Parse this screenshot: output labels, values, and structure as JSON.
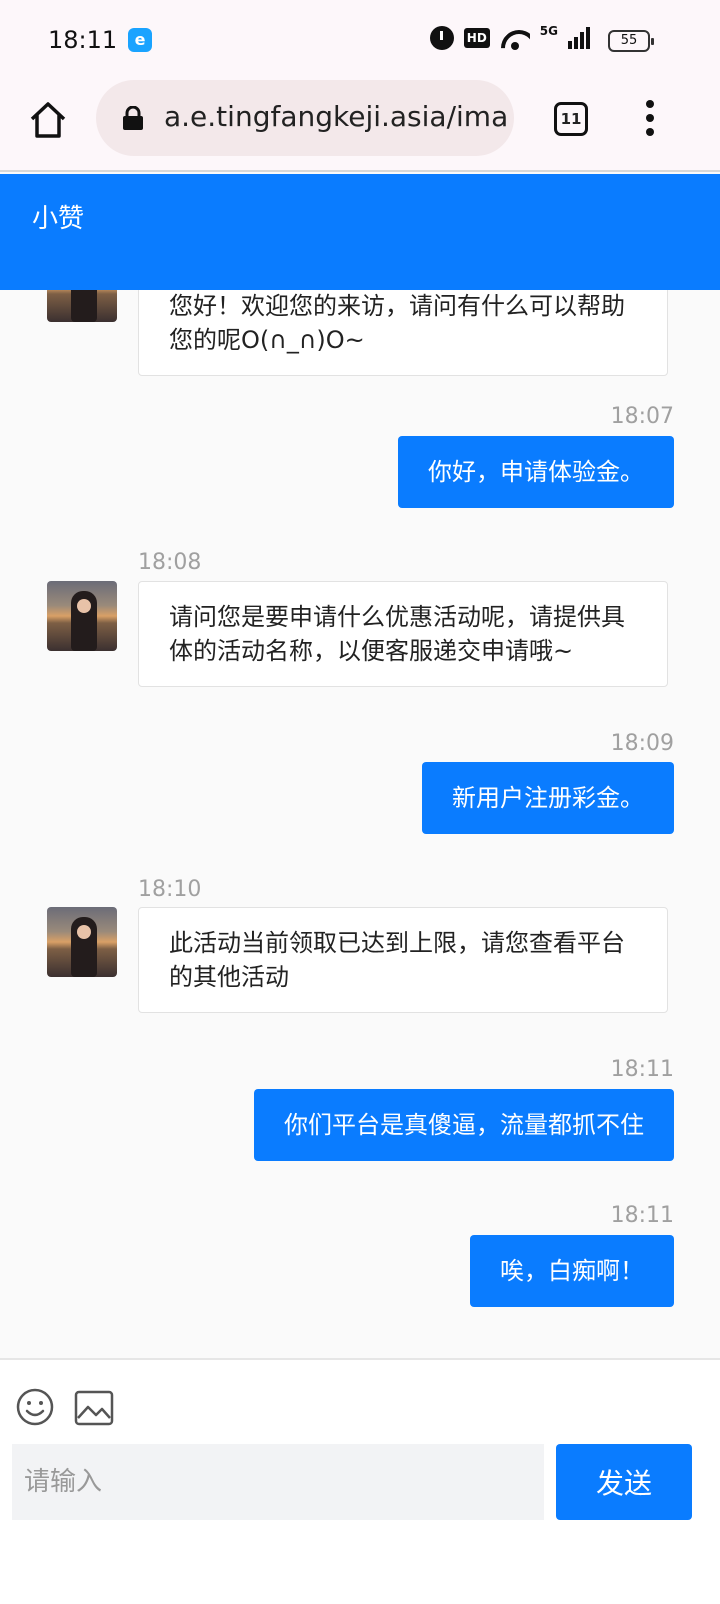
{
  "status_bar": {
    "time": "18:11",
    "hd_label": "HD",
    "network_label": "5G",
    "battery": "55"
  },
  "browser": {
    "url": "a.e.tingfangkeji.asia/ima",
    "tab_count": "11"
  },
  "chat": {
    "title": "小赞",
    "messages": [
      {
        "side": "in",
        "time": "",
        "text": "您好！欢迎您的来访，请问有什么可以帮助您的呢O(∩_∩)O~"
      },
      {
        "side": "out",
        "time": "18:07",
        "text": "你好，申请体验金。"
      },
      {
        "side": "in",
        "time": "18:08",
        "text": "请问您是要申请什么优惠活动呢，请提供具体的活动名称，以便客服递交申请哦~"
      },
      {
        "side": "out",
        "time": "18:09",
        "text": "新用户注册彩金。"
      },
      {
        "side": "in",
        "time": "18:10",
        "text": "此活动当前领取已达到上限，请您查看平台的其他活动"
      },
      {
        "side": "out",
        "time": "18:11",
        "text": "你们平台是真傻逼，流量都抓不住"
      },
      {
        "side": "out",
        "time": "18:11",
        "text": "唉，白痴啊！"
      }
    ]
  },
  "composer": {
    "placeholder": "请输入",
    "send_label": "发送"
  }
}
